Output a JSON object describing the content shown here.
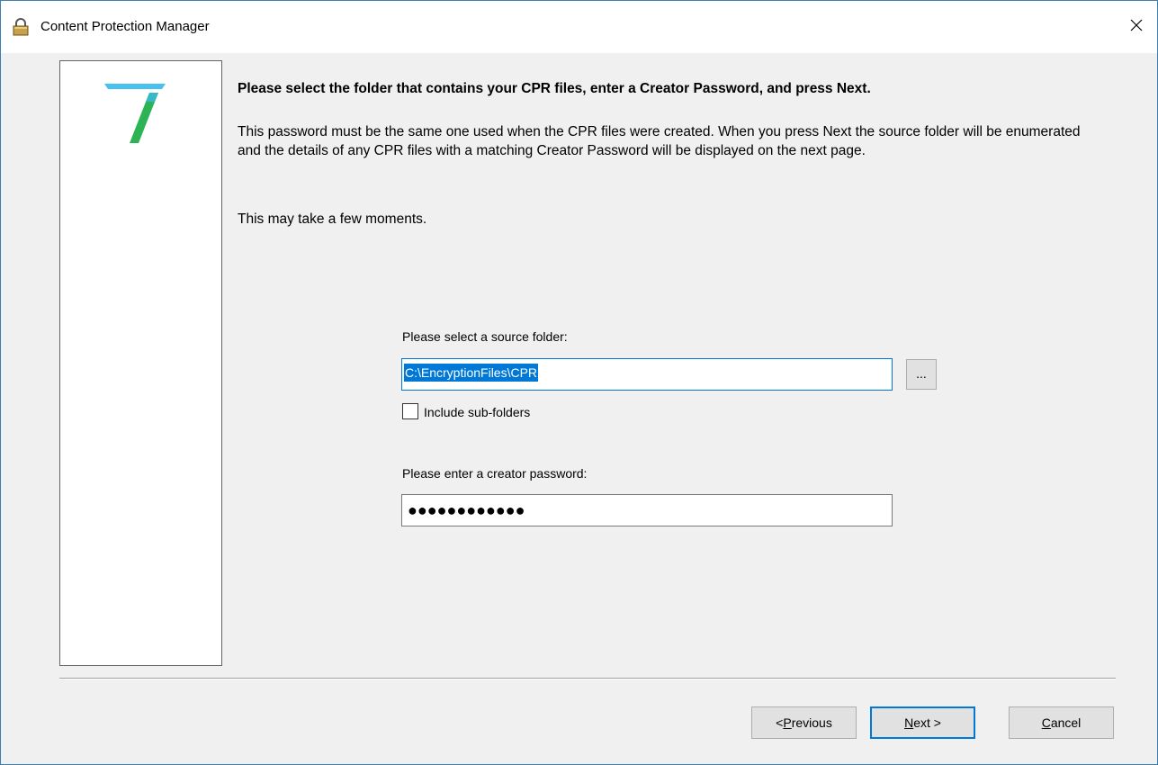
{
  "window": {
    "title": "Content Protection Manager",
    "close_glyph": "✕",
    "lock_icon": "lock-icon"
  },
  "logo": {
    "accent_top": "#47c1ee",
    "accent_bottom": "#2cb454"
  },
  "content": {
    "heading": "Please select the folder that contains your CPR files, enter a Creator Password, and press Next.",
    "paragraph": "This password must be the same one used when the CPR files were created. When you press Next the source folder will be enumerated and the details of any CPR files with a matching Creator Password will be displayed on the next page.",
    "paragraph2": "This may take a few moments."
  },
  "source": {
    "label": "Please select a source folder:",
    "value": "C:\\EncryptionFiles\\CPR",
    "browse_label": "...",
    "include_subfolders_label": "Include sub-folders",
    "include_subfolders_checked": false
  },
  "password": {
    "label": "Please enter a creator password:",
    "masked_value": "●●●●●●●●●●●●"
  },
  "buttons": {
    "previous_prefix": "< ",
    "previous_mnemonic": "P",
    "previous_rest": "revious",
    "next_mnemonic": "N",
    "next_rest": "ext >",
    "cancel_mnemonic": "C",
    "cancel_rest": "ancel"
  }
}
